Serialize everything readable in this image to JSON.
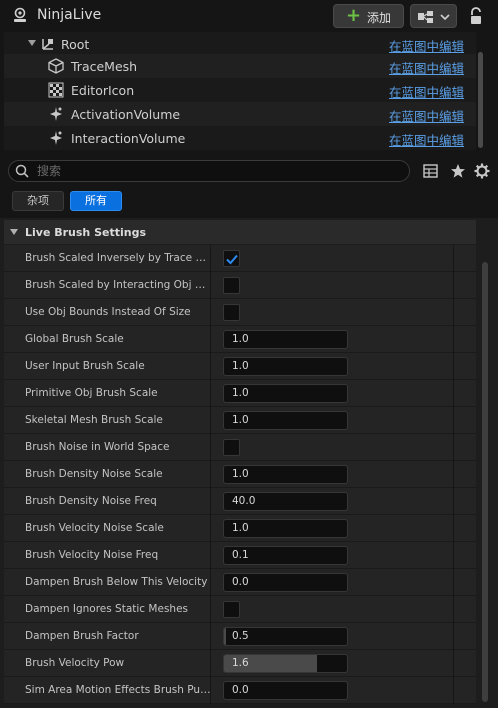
{
  "header": {
    "title": "NinjaLive",
    "add_label": "添加",
    "actor_icon": "actor-icon",
    "lock_icon": "lock-icon",
    "blueprint_icon": "blueprint-icon"
  },
  "tree": {
    "items": [
      {
        "label": "Root",
        "link": "在蓝图中编辑",
        "icon": "scene-component-icon"
      },
      {
        "label": "TraceMesh",
        "link": "在蓝图中编辑",
        "icon": "static-mesh-icon"
      },
      {
        "label": "EditorIcon",
        "link": "在蓝图中编辑",
        "icon": "billboard-icon"
      },
      {
        "label": "ActivationVolume",
        "link": "在蓝图中编辑",
        "icon": "volume-icon"
      },
      {
        "label": "InteractionVolume",
        "link": "在蓝图中编辑",
        "icon": "volume-icon"
      }
    ]
  },
  "search": {
    "placeholder": "搜索"
  },
  "filters": {
    "misc": "杂项",
    "all": "所有"
  },
  "section": {
    "title": "Live Brush Settings"
  },
  "properties": [
    {
      "name": "Brush Scaled Inversely by Trace Mesh",
      "type": "bool",
      "checked": true
    },
    {
      "name": "Brush Scaled by Interacting Obj Size",
      "type": "bool",
      "checked": false
    },
    {
      "name": "Use Obj Bounds Instead Of Size",
      "type": "bool",
      "checked": false
    },
    {
      "name": "Global Brush Scale",
      "type": "num",
      "value": "1.0"
    },
    {
      "name": "User Input Brush Scale",
      "type": "num",
      "value": "1.0"
    },
    {
      "name": "Primitive Obj Brush Scale",
      "type": "num",
      "value": "1.0"
    },
    {
      "name": "Skeletal Mesh Brush Scale",
      "type": "num",
      "value": "1.0"
    },
    {
      "name": "Brush Noise in World Space",
      "type": "bool",
      "checked": false
    },
    {
      "name": "Brush Density Noise Scale",
      "type": "num",
      "value": "1.0"
    },
    {
      "name": "Brush Density Noise Freq",
      "type": "num",
      "value": "40.0"
    },
    {
      "name": "Brush Velocity Noise Scale",
      "type": "num",
      "value": "1.0"
    },
    {
      "name": "Brush Velocity Noise Freq",
      "type": "num",
      "value": "0.1"
    },
    {
      "name": "Dampen Brush Below This Velocity",
      "type": "num",
      "value": "0.0"
    },
    {
      "name": "Dampen Ignores Static Meshes",
      "type": "bool",
      "checked": false
    },
    {
      "name": "Dampen Brush Factor",
      "type": "slider",
      "value": "0.5",
      "fraction": 0.02
    },
    {
      "name": "Brush Velocity Pow",
      "type": "slider",
      "value": "1.6",
      "fraction": 0.76
    },
    {
      "name": "Sim Area Motion Effects Brush Punch",
      "type": "num",
      "value": "0.0"
    }
  ],
  "colors": {
    "accent": "#0a70e0",
    "link": "#5a9fe6",
    "add_plus": "#6dc245",
    "check": "#2d8cf0"
  }
}
